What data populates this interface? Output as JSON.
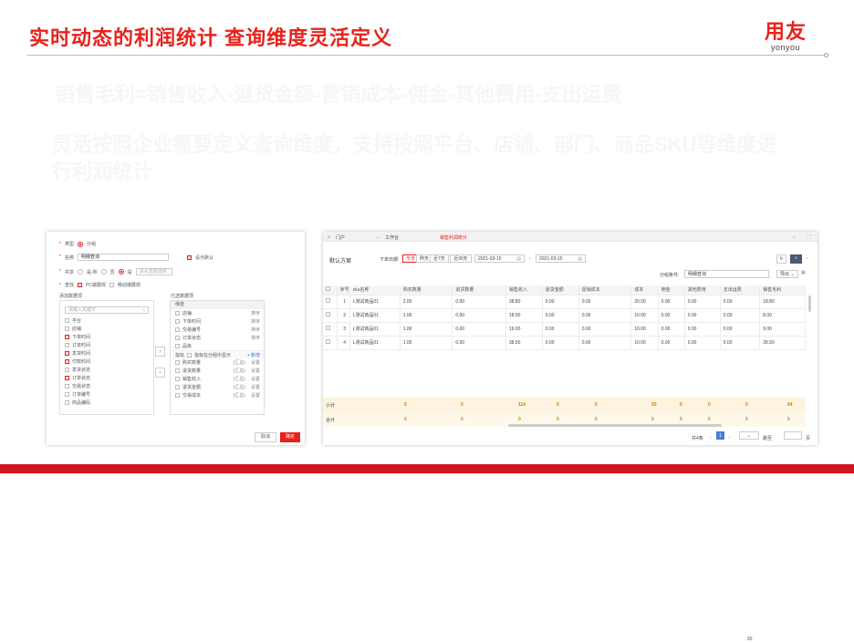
{
  "slide": {
    "title": "实时动态的利润统计 查询维度灵活定义",
    "subtitle_ghost": "销售毛利=销售收入-退货金额-营销成本-佣金-其他费用-支出运费",
    "desc_ghost": "灵活按照企业需要定义查询维度，支持按照平台、店铺、部门、商品SKU等维度进行利润统计",
    "logo_cn": "用友",
    "logo_en": "yonyou"
  },
  "dialog": {
    "type_label": "类型",
    "type_value": "分组",
    "name_label": "名称",
    "name_value": "明细查询",
    "default_label": "设为默认",
    "share_label": "共享",
    "share_opt1": "是-所",
    "share_opt2": "否",
    "share_opt3": "是",
    "share_placeholder": "请从遗报选择",
    "scene_label": "查找",
    "scene_opt1": "PC端展现",
    "scene_opt2": "移动端展现",
    "left_title": "添加数据项",
    "search_placeholder": "请输入关键字",
    "left_items": [
      "平台",
      "店铺",
      "下单时间",
      "订单时间",
      "发货时间",
      "付款时间",
      "发货状态",
      "订单状态",
      "交易状态",
      "订单编号",
      "商品编码"
    ],
    "right_title": "已选数据项",
    "right_group": "维度",
    "right_dims": [
      {
        "name": "店铺",
        "act": "排序"
      },
      {
        "name": "下单时间",
        "act": "排序"
      },
      {
        "name": "交易编号",
        "act": "排序"
      },
      {
        "name": "订单状态",
        "act": "排序"
      },
      {
        "name": "品级",
        "act": ""
      }
    ],
    "indicator_label": "指标",
    "indicator_note": "指标在分组中显示",
    "add_label": "+ 新增",
    "right_metrics": [
      {
        "name": "购买数量",
        "agg": "(汇总)",
        "act": "设置"
      },
      {
        "name": "退货数量",
        "agg": "(汇总)",
        "act": "设置"
      },
      {
        "name": "销售收入",
        "agg": "(汇总)",
        "act": "设置"
      },
      {
        "name": "退货金额",
        "agg": "(汇总)",
        "act": "设置"
      },
      {
        "name": "交易成本",
        "agg": "(汇总)",
        "act": "设置"
      }
    ],
    "cancel": "取消",
    "confirm": "确定"
  },
  "window": {
    "home": "门户",
    "workbench": "工作台",
    "active_tab": "销售利润统计",
    "scheme": "默认方案",
    "order_date_label": "下单日期",
    "date_buttons": [
      "今天",
      "昨天",
      "近7天",
      "近30天"
    ],
    "date_from": "2021-03-15",
    "date_sep": "-",
    "date_to": "2021-03-15",
    "group_label": "分组条件:",
    "group_value": "明细查询",
    "export": "导出",
    "columns": [
      "",
      "序号",
      "sku名称",
      "购买数量",
      "退货数量",
      "销售收入",
      "退货金额",
      "促销成本",
      "成本",
      "佣金",
      "其他费用",
      "支出运费",
      "销售毛利"
    ],
    "rows": [
      [
        "",
        "1",
        "L测试商品01",
        "2.00",
        "0.00",
        "38.80",
        "0.00",
        "0.00",
        "20.00",
        "0.00",
        "0.00",
        "0.00",
        "18.80"
      ],
      [
        "",
        "2",
        "L测试商品01",
        "1.00",
        "0.00",
        "18.00",
        "0.00",
        "0.00",
        "10.00",
        "0.00",
        "0.00",
        "0.00",
        "8.00"
      ],
      [
        "",
        "3",
        "L测试商品01",
        "1.00",
        "0.00",
        "19.00",
        "0.00",
        "0.00",
        "10.00",
        "0.00",
        "0.00",
        "0.00",
        "9.00"
      ],
      [
        "",
        "4",
        "L测试商品01",
        "1.00",
        "0.00",
        "38.50",
        "0.00",
        "0.00",
        "10.00",
        "0.00",
        "0.00",
        "0.00",
        "28.50"
      ]
    ],
    "subtotal_label": "小计",
    "subtotal": [
      "5",
      "0",
      "114",
      "0",
      "0",
      "50",
      "0",
      "0",
      "0",
      "64"
    ],
    "total_label": "合计",
    "total": [
      "0",
      "0",
      "0",
      "0",
      "0",
      "0",
      "0",
      "0",
      "0",
      "0"
    ],
    "pager_total": "共4条",
    "pager_page": "1",
    "pager_size": "20",
    "pager_goto": "跳至",
    "pager_unit": "页"
  }
}
